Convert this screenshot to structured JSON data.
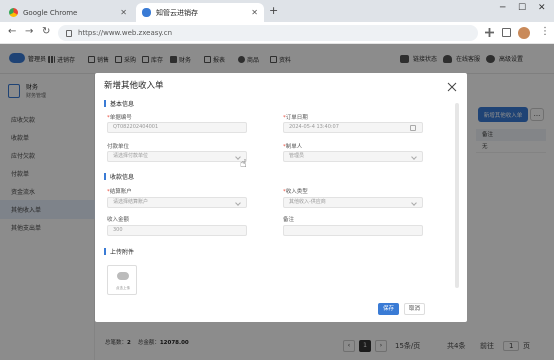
{
  "browser": {
    "tabs": [
      {
        "title": "Google Chrome",
        "active": false
      },
      {
        "title": "知管云进销存",
        "active": true
      }
    ],
    "url": "https://www.web.zxeasy.cn"
  },
  "app": {
    "logo_text": "管理员",
    "menu": [
      "进销存",
      "销售",
      "采购",
      "库存",
      "财务",
      "报表",
      "商品",
      "资料"
    ],
    "right_menu": [
      "链接状态",
      "在线客服",
      "高级设置"
    ]
  },
  "sidebar": {
    "title": "财务",
    "subtitle": "财务管理",
    "items": [
      {
        "label": "应收欠款",
        "active": false
      },
      {
        "label": "收款单",
        "active": false
      },
      {
        "label": "应付欠款",
        "active": false
      },
      {
        "label": "付款单",
        "active": false
      },
      {
        "label": "资金流水",
        "active": false
      },
      {
        "label": "其他收入单",
        "active": true
      },
      {
        "label": "其他支出单",
        "active": false
      }
    ]
  },
  "background": {
    "new_button": "新增其他收入单",
    "more_button": "...",
    "table_header": "备注",
    "table_cell": "无"
  },
  "footer": {
    "total_label": "总笔数：",
    "total_value": "2",
    "amount_label": "总金额：",
    "amount_value": "12078.00",
    "current_page": "1",
    "page_size": "15条/页",
    "total_items": "共4条",
    "goto_label": "前往",
    "goto_value": "1",
    "page_suffix": "页"
  },
  "modal": {
    "title": "新增其他收入单",
    "sections": {
      "basic": "基本信息",
      "payment": "收款信息",
      "upload": "上传附件"
    },
    "fields": {
      "doc_no_label": "单据编号",
      "doc_no_value": "QT082202404001",
      "order_date_label": "订单日期",
      "order_date_value": "2024-05-4 13:40:07",
      "payer_label": "付款单位",
      "payer_placeholder": "请选择付款单位",
      "creator_label": "制单人",
      "creator_value": "管理员",
      "account_label": "结算账户",
      "account_placeholder": "请选择结算账户",
      "income_type_label": "收入类型",
      "income_type_value": "其他收入-供应商",
      "amount_label": "收入金额",
      "amount_value": "300",
      "remark_label": "备注",
      "remark_value": ""
    },
    "upload_hint": "点击上传",
    "save_label": "保存",
    "cancel_label": "取消"
  }
}
